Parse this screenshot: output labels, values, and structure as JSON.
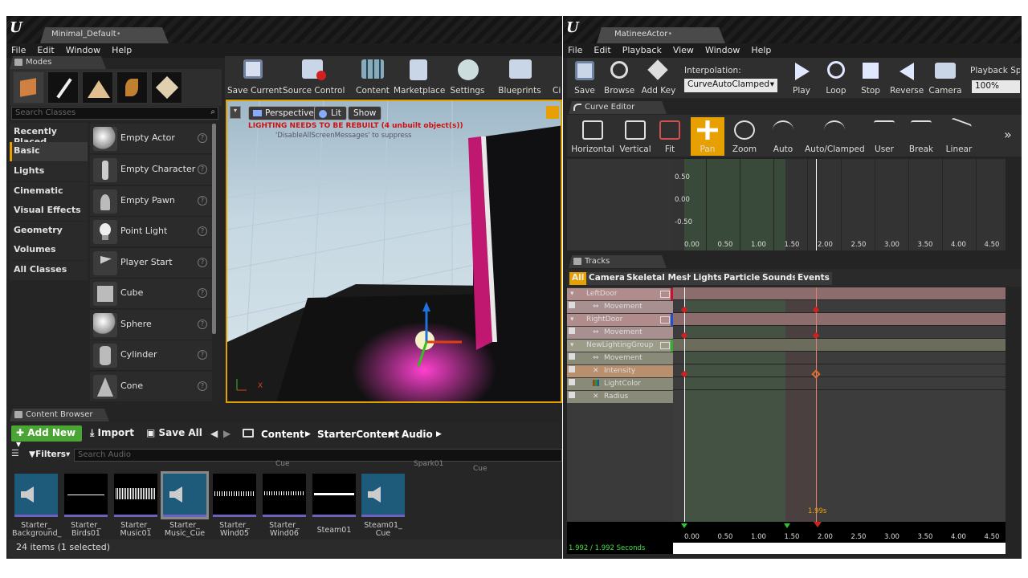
{
  "left_window": {
    "logo": "U",
    "tab_title": "Minimal_Default",
    "menu": [
      "File",
      "Edit",
      "Window",
      "Help"
    ],
    "modes_tab": "Modes",
    "search_placeholder": "Search Classes",
    "categories": [
      "Recently Placed",
      "Basic",
      "Lights",
      "Cinematic",
      "Visual Effects",
      "Geometry",
      "Volumes",
      "All Classes"
    ],
    "items": [
      "Empty Actor",
      "Empty Character",
      "Empty Pawn",
      "Point Light",
      "Player Start",
      "Cube",
      "Sphere",
      "Cylinder",
      "Cone"
    ],
    "toolbar": [
      "Save Current",
      "Source Control",
      "Content",
      "Marketplace",
      "Settings",
      "Blueprints",
      "Ci"
    ],
    "viewport": {
      "perspective": "Perspective",
      "lit": "Lit",
      "show": "Show",
      "warning": "LIGHTING NEEDS TO BE REBUILT (4 unbuilt object(s))",
      "suppress": "'DisableAllScreenMessages' to suppress",
      "axis_x": "X"
    },
    "content_browser": {
      "tab": "Content Browser",
      "add_new": "Add New",
      "import": "Import",
      "save_all": "Save All",
      "path": [
        "Content",
        "StarterContent",
        "Audio"
      ],
      "filters": "Filters",
      "search_placeholder": "Search Audio",
      "assets": [
        "Starter_ Background_",
        "Starter_ Birds01",
        "Starter_ Music01",
        "Starter_ Music_Cue",
        "Starter_ Wind05",
        "Starter_ Wind06",
        "Steam01",
        "Steam01_ Cue"
      ],
      "status": "24 items (1 selected)",
      "peek_labels": [
        "Cue",
        "Spark01",
        "Cue"
      ]
    }
  },
  "right_window": {
    "logo": "U",
    "tab_title": "MatineeActor",
    "menu": [
      "File",
      "Edit",
      "Playback",
      "View",
      "Window",
      "Help"
    ],
    "toolbar": [
      "Save",
      "Browse",
      "Add Key",
      "Play",
      "Loop",
      "Stop",
      "Reverse",
      "Camera"
    ],
    "interpolation_label": "Interpolation:",
    "interpolation_value": "CurveAutoClamped",
    "playback_speed_label": "Playback Spe",
    "playback_speed_value": "100%",
    "curve_editor": {
      "tab": "Curve Editor",
      "buttons": [
        "Horizontal",
        "Vertical",
        "Fit",
        "Pan",
        "Zoom",
        "Auto",
        "Auto/Clamped",
        "User",
        "Break",
        "Linear"
      ],
      "y_ticks": [
        "0.50",
        "0.00",
        "-0.50"
      ],
      "x_ticks": [
        "0.00",
        "0.50",
        "1.00",
        "1.50",
        "2.00",
        "2.50",
        "3.00",
        "3.50",
        "4.00",
        "4.50"
      ]
    },
    "tracks": {
      "tab": "Tracks",
      "filters": [
        "All",
        "Cameras",
        "Skeletal Meshes",
        "Lights",
        "Particles",
        "Sounds",
        "Events"
      ],
      "rows": [
        "LeftDoor",
        "Movement",
        "RightDoor",
        "Movement",
        "NewLightingGroup",
        "Movement",
        "Intensity",
        "LightColor",
        "Radius"
      ],
      "time_marker": "1.99s",
      "x_ticks": [
        "0.00",
        "0.50",
        "1.00",
        "1.50",
        "2.00",
        "2.50",
        "3.00",
        "3.50",
        "4.00",
        "4.50"
      ],
      "time_readout": "1.992 / 1.992 Seconds"
    }
  },
  "colors": {
    "accent": "#e8a000",
    "add_new": "#4aa534",
    "left_door": "#c8102e",
    "right_door": "#2050d0",
    "lighting_group": "#30b030"
  }
}
